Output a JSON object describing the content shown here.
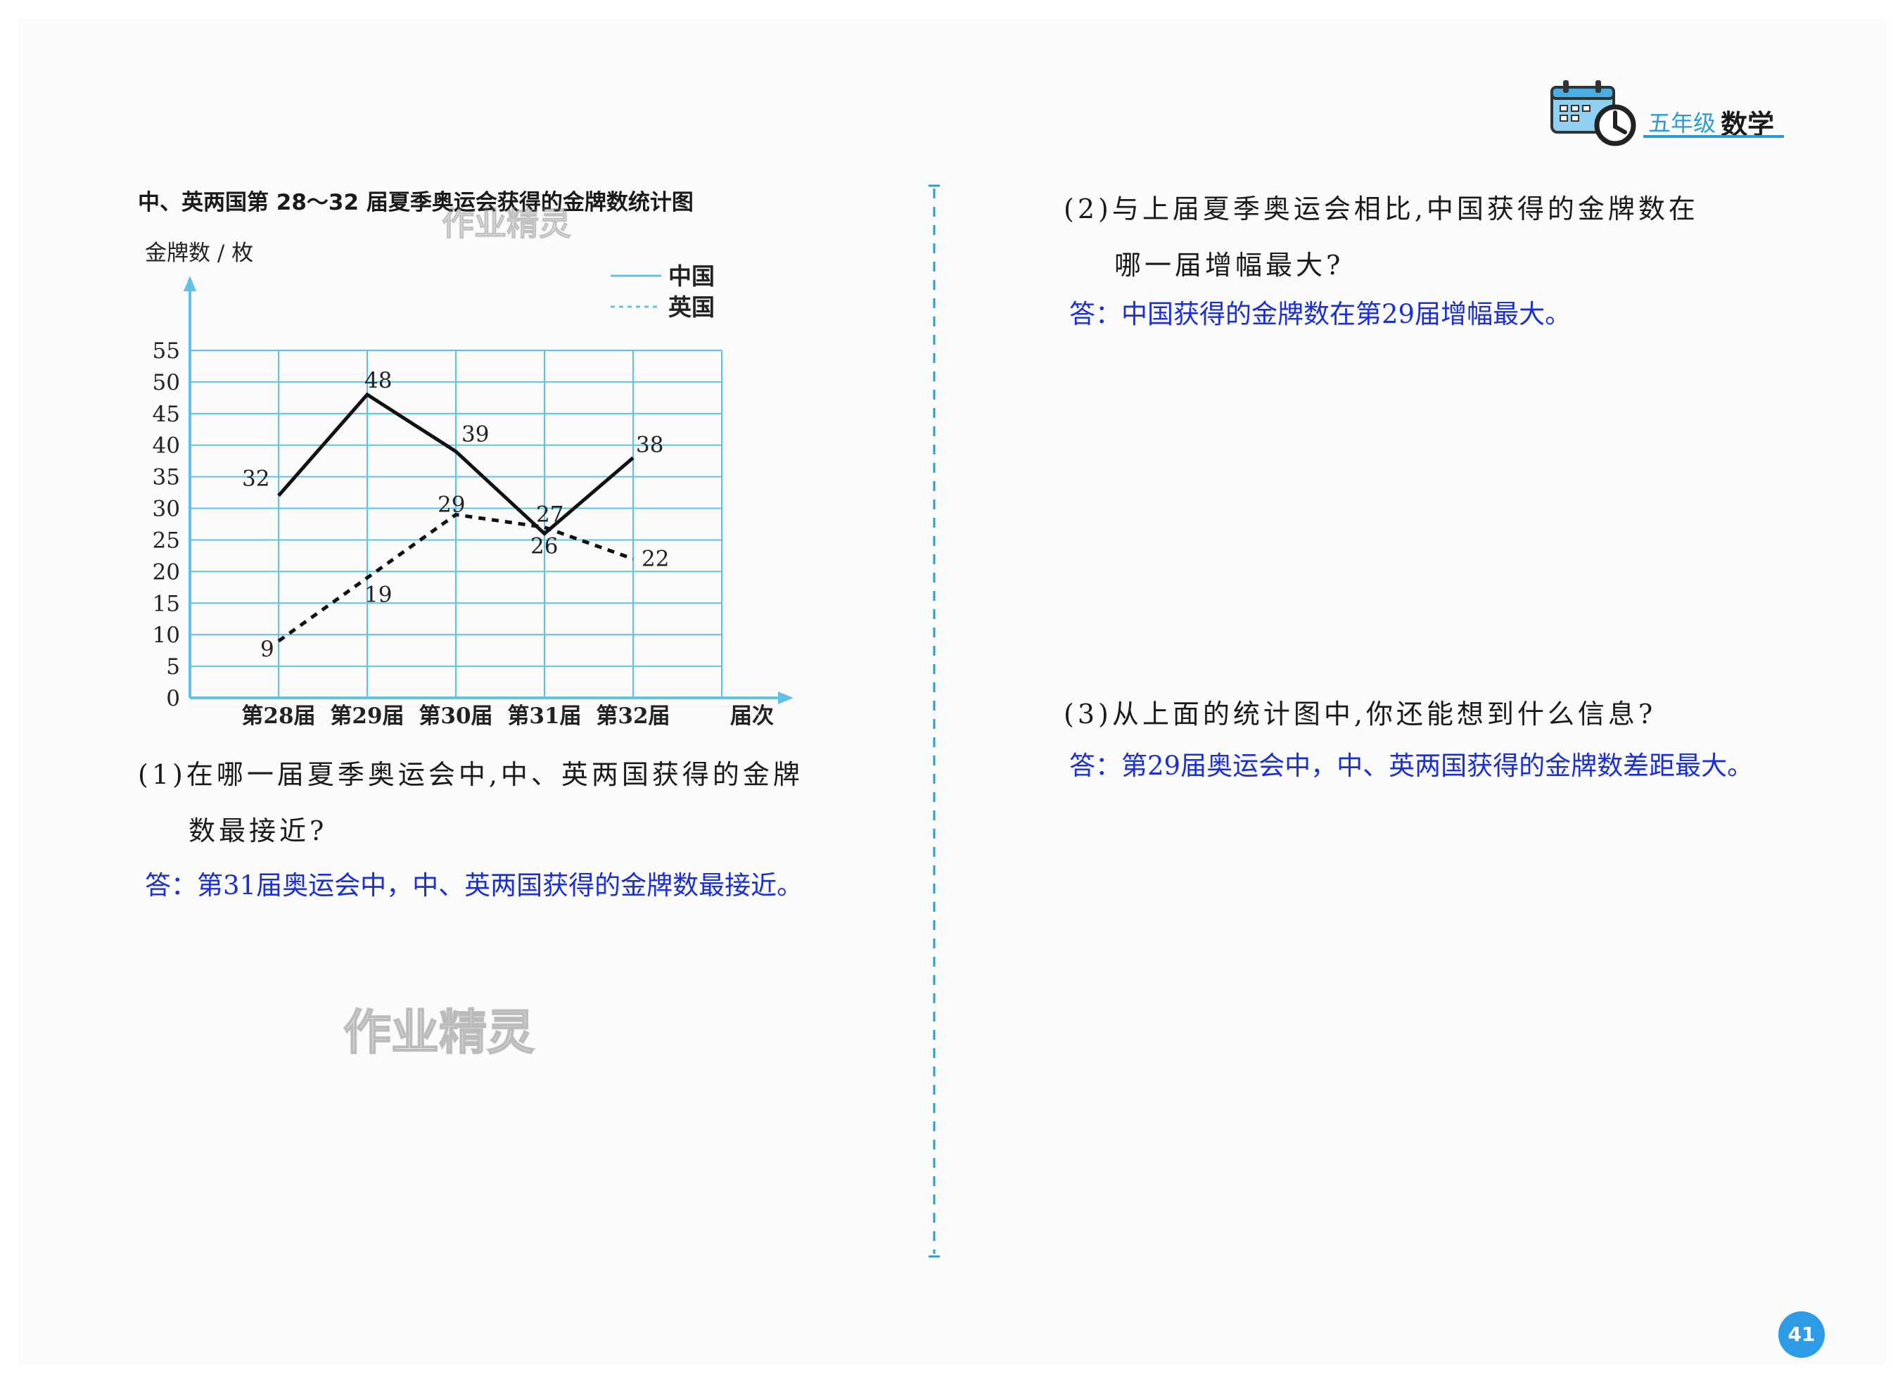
{
  "header": {
    "grade": "五年级",
    "subject": "数学",
    "accent_color": "#2a9bd8",
    "icon": "calendar-clock-icon"
  },
  "chart_title": "中、英两国第 28～32 届夏季奥运会获得的金牌数统计图",
  "chart_data": {
    "type": "line",
    "title": "中、英两国第 28～32 届夏季奥运会获得的金牌数统计图",
    "ylabel": "金牌数 / 枚",
    "xlabel": "届次",
    "categories": [
      "第28届",
      "第29届",
      "第30届",
      "第31届",
      "第32届"
    ],
    "yticks": [
      "0",
      "5",
      "10",
      "15",
      "20",
      "25",
      "30",
      "35",
      "40",
      "45",
      "50",
      "55"
    ],
    "ylim": [
      0,
      55
    ],
    "grid": true,
    "grid_color": "#5fc0e8",
    "legend_position": "top-right",
    "series": [
      {
        "name": "中国",
        "style": "solid",
        "values": [
          32,
          48,
          39,
          26,
          38
        ],
        "labels": [
          "32",
          "48",
          "39",
          "26",
          "38"
        ]
      },
      {
        "name": "英国",
        "style": "dashed",
        "values": [
          9,
          19,
          29,
          27,
          22
        ],
        "labels": [
          "9",
          "19",
          "29",
          "27",
          "22"
        ]
      }
    ]
  },
  "questions": {
    "q1_line1": "(1)在哪一届夏季奥运会中,中、英两国获得的金牌",
    "q1_line2": "数最接近?",
    "a1": "答：第31届奥运会中，中、英两国获得的金牌数最接近。",
    "q2_line1": "(2)与上届夏季奥运会相比,中国获得的金牌数在",
    "q2_line2": "哪一届增幅最大?",
    "a2": "答：中国获得的金牌数在第29届增幅最大。",
    "q3": "(3)从上面的统计图中,你还能想到什么信息?",
    "a3": "答：第29届奥运会中，中、英两国获得的金牌数差距最大。"
  },
  "watermarks": [
    "作业精灵",
    "作业精灵"
  ],
  "page_number": "41"
}
